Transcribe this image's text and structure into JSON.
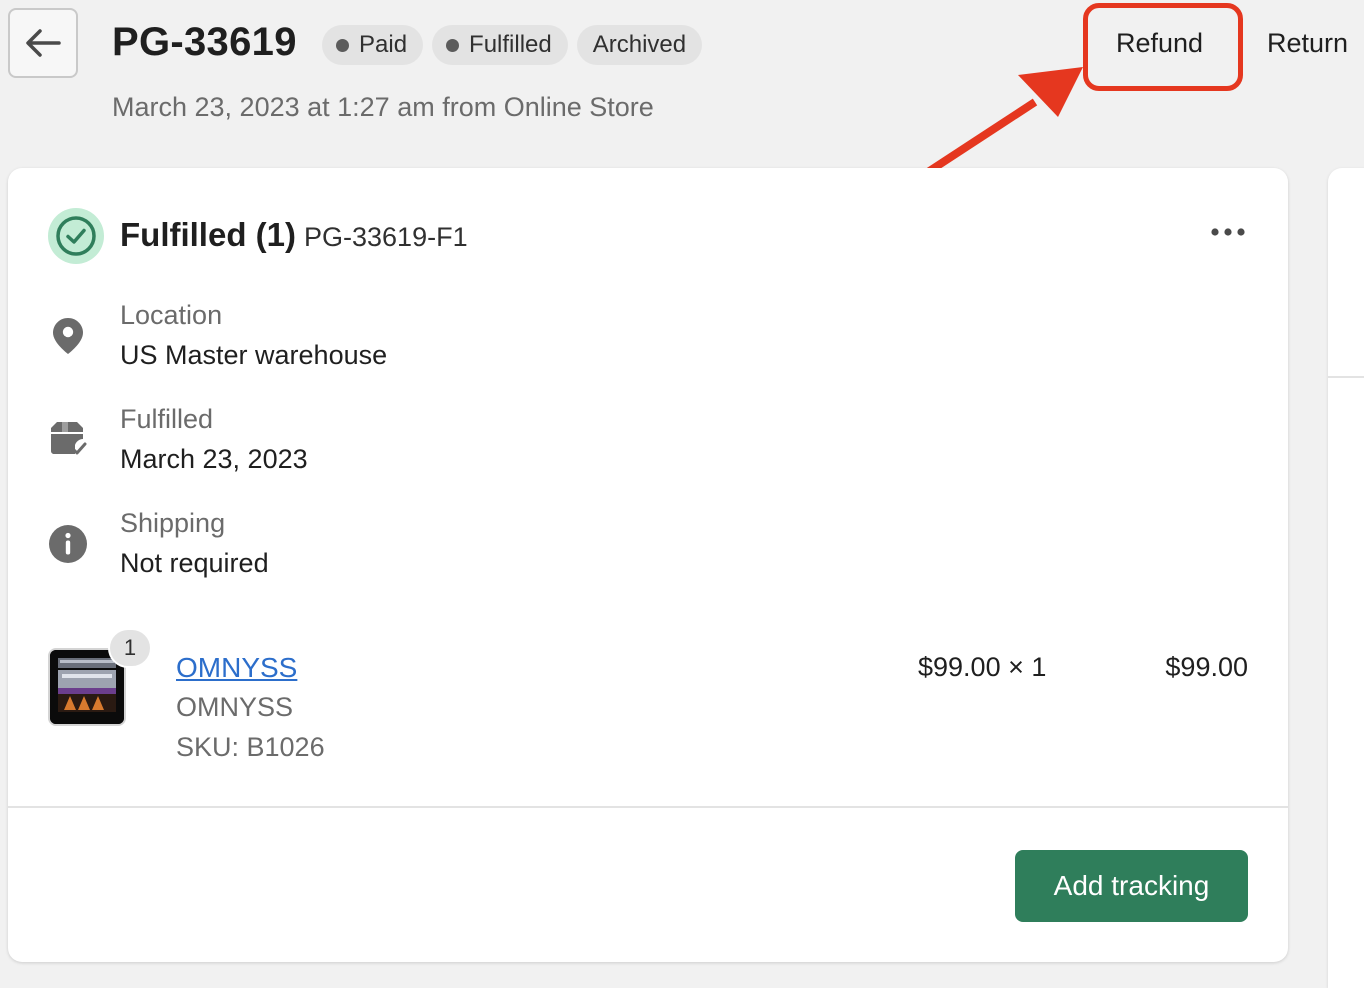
{
  "header": {
    "order_number": "PG-33619",
    "badges": [
      {
        "label": "Paid",
        "dot": true
      },
      {
        "label": "Fulfilled",
        "dot": true
      },
      {
        "label": "Archived",
        "dot": false
      }
    ],
    "subtitle": "March 23, 2023 at 1:27 am from Online Store",
    "actions": {
      "refund": "Refund",
      "return": "Return"
    }
  },
  "fulfillment": {
    "title": "Fulfilled (1)",
    "id": "PG-33619-F1",
    "location": {
      "label": "Location",
      "value": "US Master warehouse"
    },
    "fulfilled": {
      "label": "Fulfilled",
      "value": "March 23, 2023"
    },
    "shipping": {
      "label": "Shipping",
      "value": "Not required"
    },
    "line_item": {
      "quantity_badge": "1",
      "name": "OMNYSS",
      "variant": "OMNYSS",
      "sku": "SKU: B1026",
      "unit_price": "$99.00 × 1",
      "total": "$99.00"
    },
    "add_tracking_label": "Add tracking"
  },
  "colors": {
    "highlight": "#e5371f",
    "primary_button": "#2f7e5b",
    "success_bg": "#c3ecd5",
    "success_icon": "#2f7e5b",
    "link": "#2c6ecb"
  },
  "icons": {
    "back": "arrow-left-icon",
    "status": "check-circle-icon",
    "location": "location-pin-icon",
    "fulfilled": "package-check-icon",
    "shipping": "info-icon",
    "more": "more-horizontal-icon"
  }
}
